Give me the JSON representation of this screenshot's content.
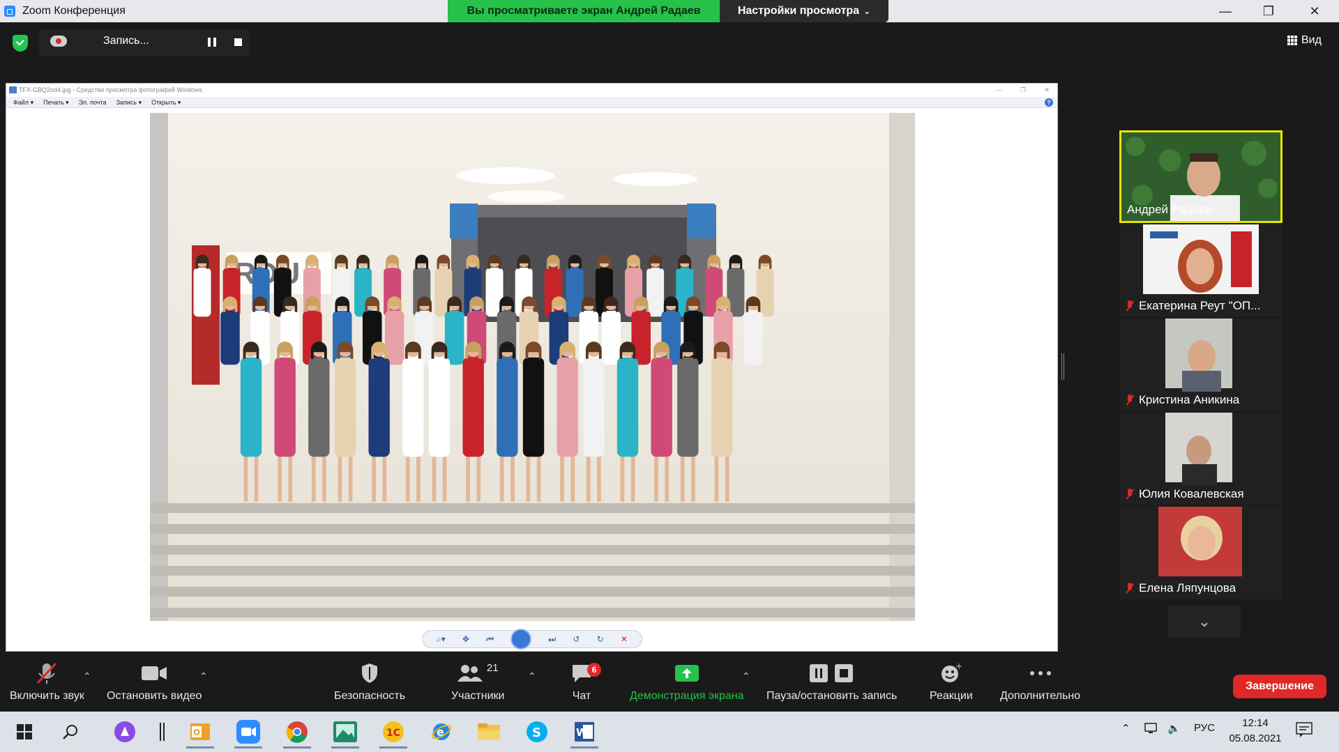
{
  "window": {
    "title": "Zoom Конференция",
    "share_banner": "Вы просматриваете экран Андрей Радаев",
    "view_settings": "Настройки просмотра",
    "min": "—",
    "max": "❐",
    "close": "✕"
  },
  "recording": {
    "label": "Запись..."
  },
  "view_button": "Вид",
  "photo_viewer": {
    "title": "TFX-GBQ2od4.jpg - Средство просмотра фотографий Windows",
    "menu": [
      "Файл ▾",
      "Печать ▾",
      "Эл. почта",
      "Запись ▾",
      "Открыть ▾"
    ],
    "help": "?"
  },
  "participants": [
    {
      "name": "Андрей Радаев",
      "active": true,
      "muted": false
    },
    {
      "name": "Екатерина Реут \"ОП...",
      "active": false,
      "muted": true
    },
    {
      "name": "Кристина Аникина",
      "active": false,
      "muted": true
    },
    {
      "name": "Юлия Ковалевская",
      "active": false,
      "muted": true
    },
    {
      "name": "Елена Ляпунцова",
      "active": false,
      "muted": true
    }
  ],
  "controls": {
    "audio": "Включить звук",
    "video": "Остановить видео",
    "security": "Безопасность",
    "participants": "Участники",
    "participants_count": "21",
    "chat": "Чат",
    "chat_badge": "6",
    "share": "Демонстрация экрана",
    "pause_record": "Пауза/остановить запись",
    "reactions": "Реакции",
    "more": "Дополнительно",
    "end": "Завершение"
  },
  "taskbar": {
    "language": "РУС",
    "time": "12:14",
    "date": "05.08.2021"
  },
  "colors": {
    "zoom_green": "#26c24a",
    "end_red": "#e02828",
    "active_speaker": "#e6e600"
  }
}
